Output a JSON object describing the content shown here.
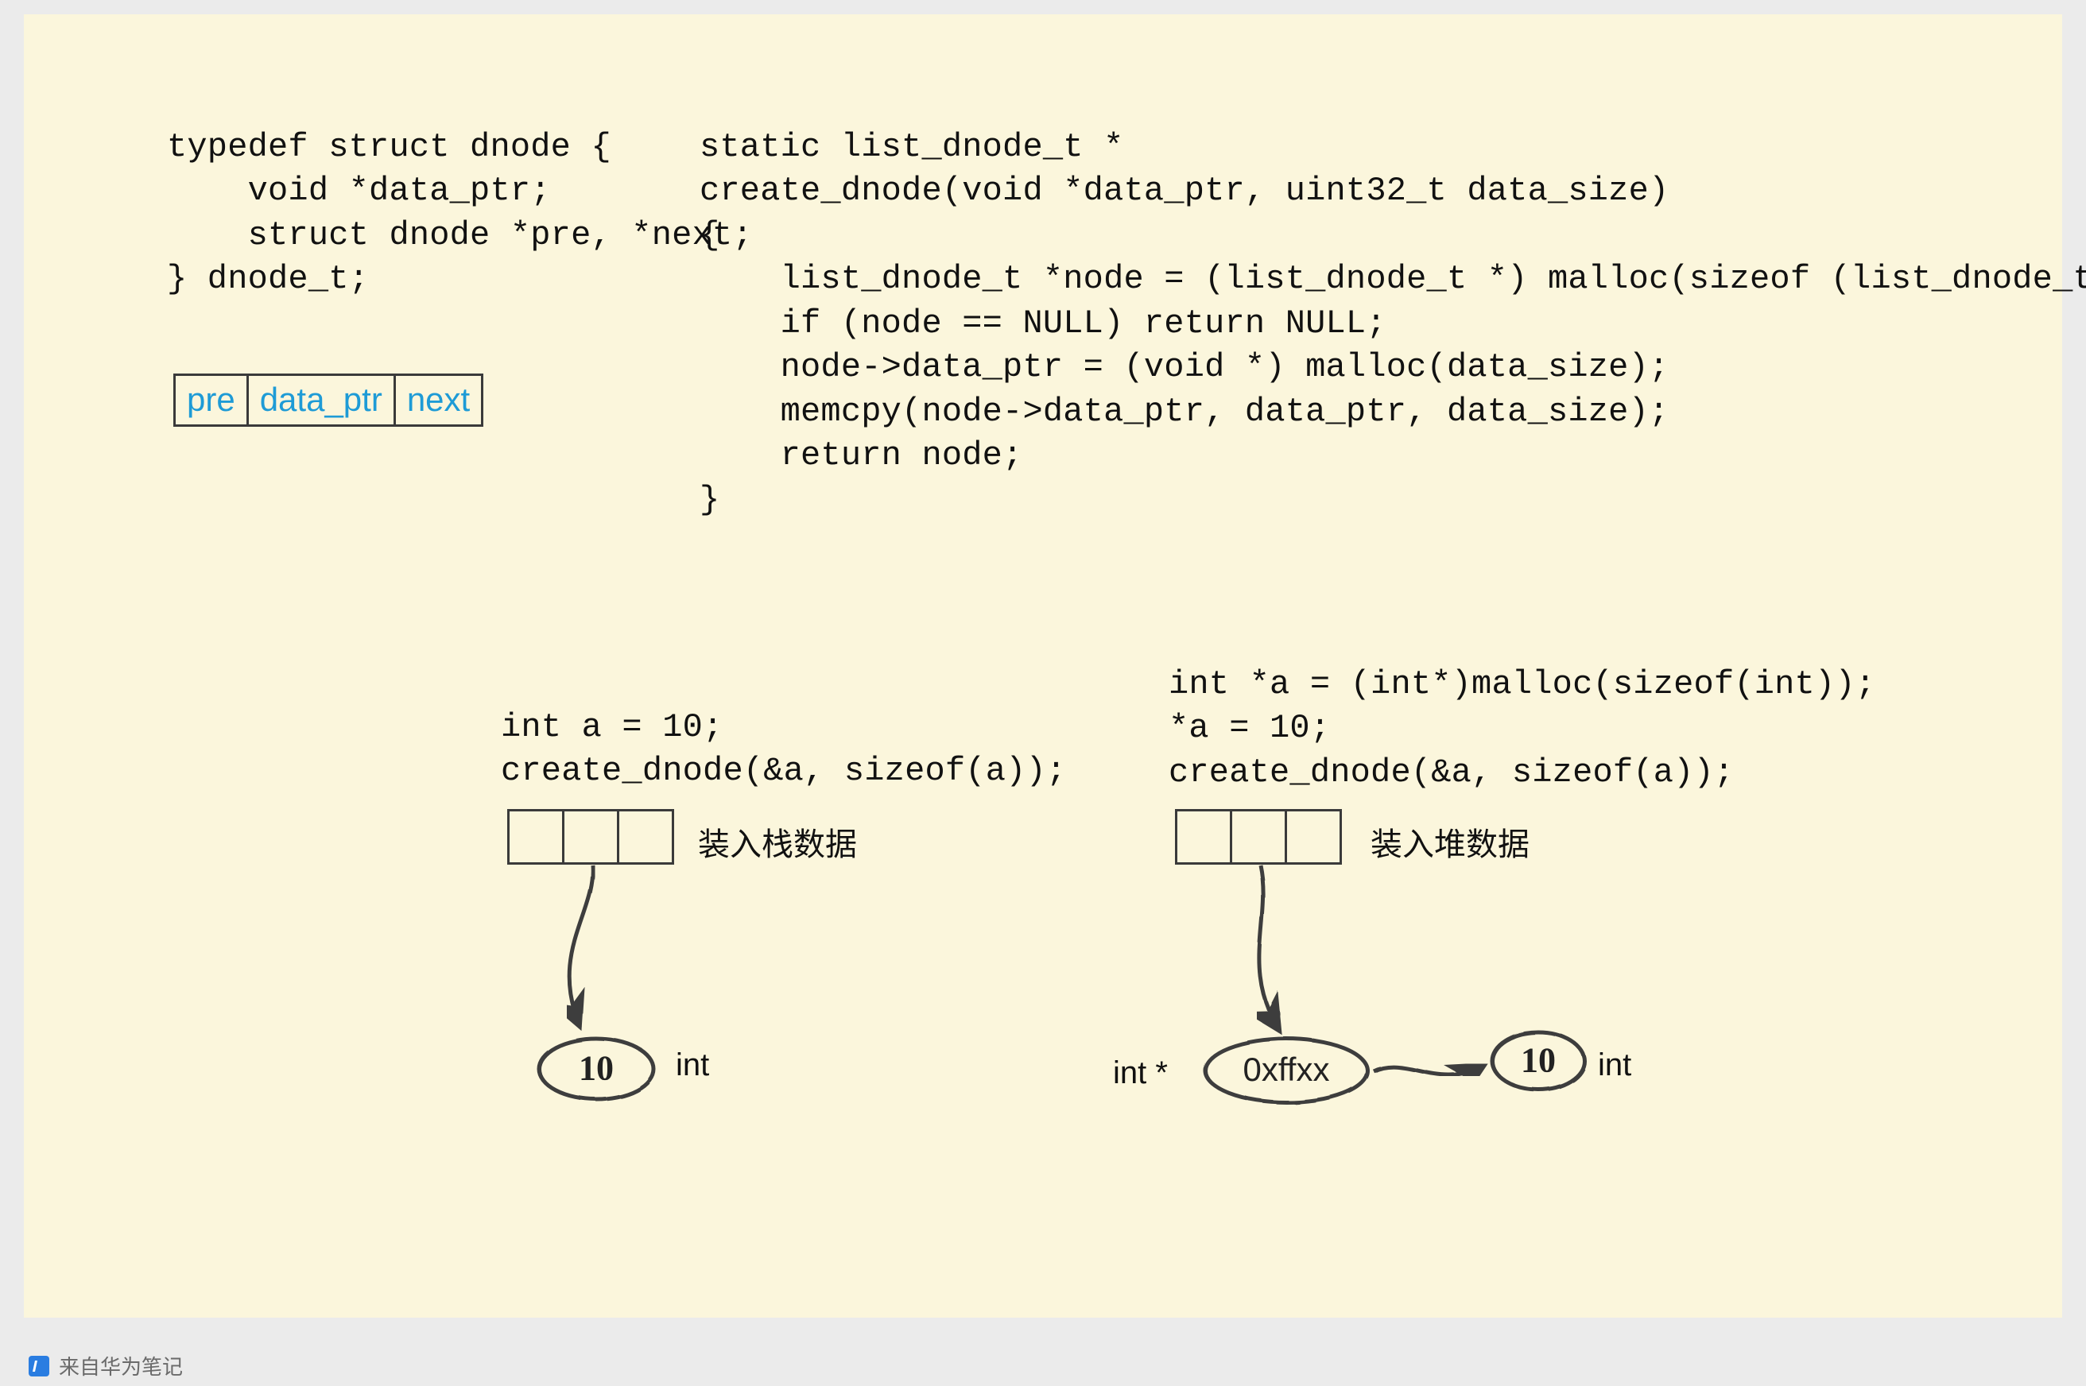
{
  "struct_def": "typedef struct dnode {\n    void *data_ptr;\n    struct dnode *pre, *next;\n} dnode_t;",
  "struct_fields": {
    "pre": "pre",
    "data_ptr": "data_ptr",
    "next": "next"
  },
  "create_fn": "static list_dnode_t *\ncreate_dnode(void *data_ptr, uint32_t data_size)\n{\n    list_dnode_t *node = (list_dnode_t *) malloc(sizeof (list_dnode_t));\n    if (node == NULL) return NULL;\n    node->data_ptr = (void *) malloc(data_size);\n    memcpy(node->data_ptr, data_ptr, data_size);\n    return node;\n}",
  "stack_example": {
    "code": "int a = 10;\ncreate_dnode(&a, sizeof(a));",
    "label": "装入栈数据",
    "value": "10",
    "value_type": "int"
  },
  "heap_example": {
    "code": "int *a = (int*)malloc(sizeof(int));\n*a = 10;\ncreate_dnode(&a, sizeof(a));",
    "label": "装入堆数据",
    "addr": "0xffxx",
    "addr_type": "int *",
    "value": "10",
    "value_type": "int"
  },
  "footer": "来自华为笔记"
}
